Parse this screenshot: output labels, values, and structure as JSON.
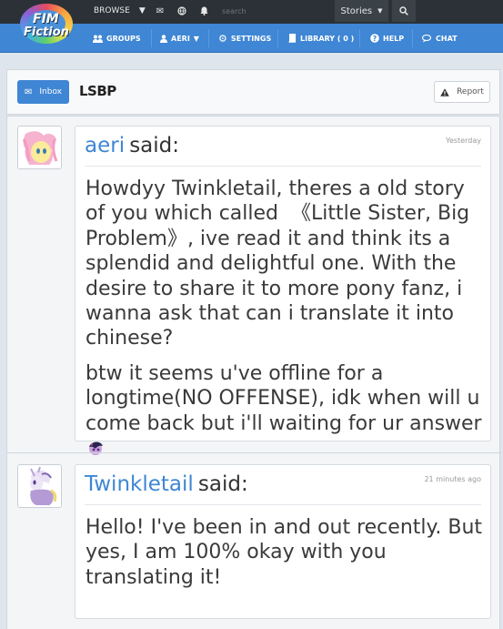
{
  "site": {
    "logo_line1": "FIM",
    "logo_line2": "Fiction"
  },
  "topbar": {
    "browse_label": "BROWSE",
    "search_placeholder": "search",
    "stories_label": "Stories"
  },
  "nav": {
    "items": [
      {
        "label": "GROUPS",
        "icon": "groups-icon"
      },
      {
        "label": "AERI",
        "icon": "user-icon"
      },
      {
        "label": "SETTINGS",
        "icon": "gear-icon"
      },
      {
        "label": "LIBRARY ( 0 )",
        "icon": "book-icon"
      },
      {
        "label": "HELP",
        "icon": "help-icon"
      },
      {
        "label": "CHAT",
        "icon": "chat-icon"
      }
    ]
  },
  "header": {
    "inbox_label": "Inbox",
    "title": "LSBP",
    "report_label": "Report"
  },
  "messages": [
    {
      "author": "aeri",
      "said": "said:",
      "time": "Yesterday",
      "paragraphs": [
        "Howdyy Twinkletail, theres a old story of you which called  《Little Sister, Big Problem》, ive read it and think its a splendid and delightful one. With the desire to share it to more pony fanz, i wanna ask that can i translate it into chinese?",
        "btw it seems u've offline for a longtime(NO OFFENSE), idk when will u come back but i'll waiting for ur answer"
      ]
    },
    {
      "author": "Twinkletail",
      "said": "said:",
      "time": "21 minutes ago",
      "paragraphs": [
        "Hello! I've been in and out recently. But yes, I am 100% okay with you translating it!"
      ]
    }
  ],
  "colors": {
    "accent": "#3f86d4",
    "topbar": "#2b3137",
    "background": "#dfe5ec"
  }
}
